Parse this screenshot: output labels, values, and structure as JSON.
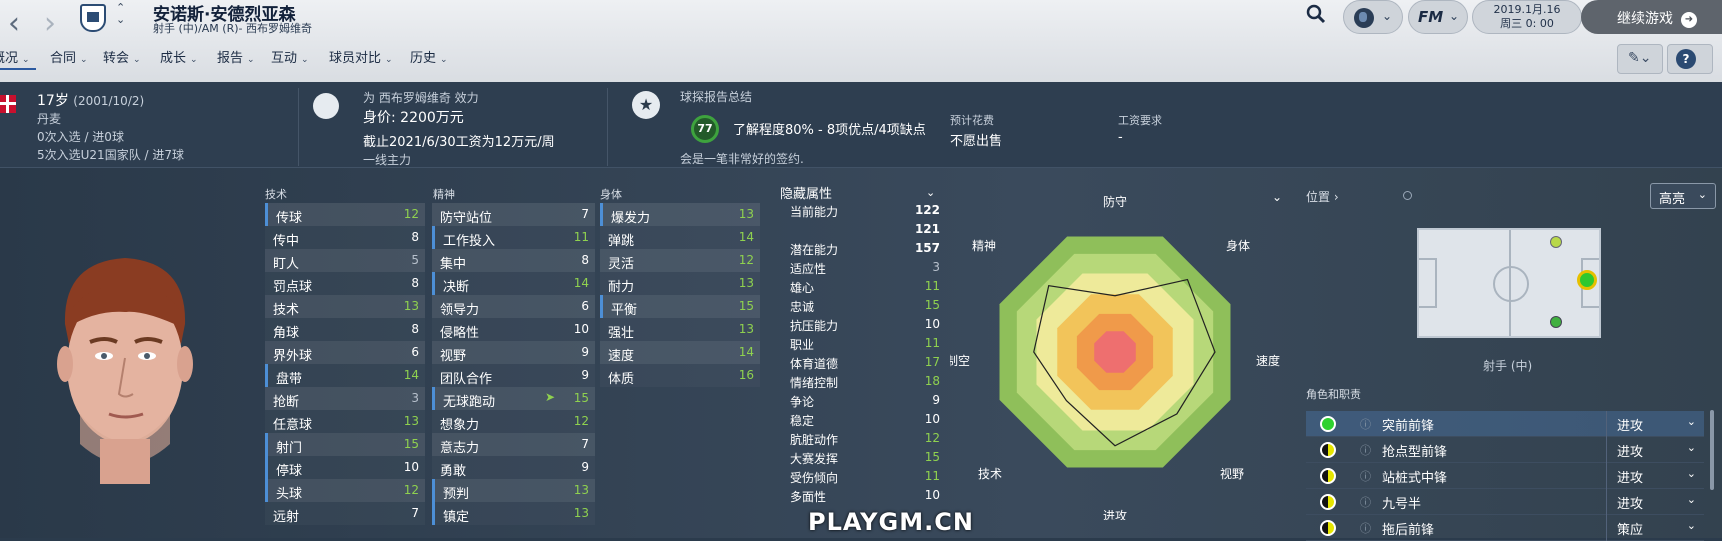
{
  "header": {
    "back_icon": "chevron-left-icon",
    "forward_icon": "chevron-right-icon",
    "player_name": "安诺斯·安德烈亚森",
    "player_role": "射手 (中)/AM (R)- 西布罗姆维奇",
    "date": "2019.1月.16",
    "time": "周三 0: 00",
    "continue_label": "继续游戏",
    "fm_label": "FM"
  },
  "tabs": [
    {
      "label": "概况"
    },
    {
      "label": "合同"
    },
    {
      "label": "转会"
    },
    {
      "label": "成长"
    },
    {
      "label": "报告"
    },
    {
      "label": "互动"
    },
    {
      "label": "球员对比"
    },
    {
      "label": "历史"
    }
  ],
  "info": {
    "age": "17岁",
    "birth": "(2001/10/2)",
    "nation": "丹麦",
    "caps1": "0次入选 / 进0球",
    "caps2": "5次入选U21国家队 / 进7球",
    "club_line": "为 西布罗姆维奇 效力",
    "value": "身价: 2200万元",
    "contract": "截止2021/6/30工资为12万元/周",
    "squad": "一线主力",
    "scout_title": "球探报告总结",
    "scout_score": "77",
    "scout_text": "了解程度80% - 8项优点/4项缺点",
    "scout_note": "会是一笔非常好的签约.",
    "fee_label": "预计花费",
    "fee_value": "不愿出售",
    "wage_label": "工资要求",
    "wage_value": "-"
  },
  "attributes": {
    "technical_title": "技术",
    "technical": [
      {
        "name": "传球",
        "value": "12"
      },
      {
        "name": "传中",
        "value": "8"
      },
      {
        "name": "盯人",
        "value": "5"
      },
      {
        "name": "罚点球",
        "value": "8"
      },
      {
        "name": "技术",
        "value": "13"
      },
      {
        "name": "角球",
        "value": "8"
      },
      {
        "name": "界外球",
        "value": "6"
      },
      {
        "name": "盘带",
        "value": "14"
      },
      {
        "name": "抢断",
        "value": "3"
      },
      {
        "name": "任意球",
        "value": "13"
      },
      {
        "name": "射门",
        "value": "15"
      },
      {
        "name": "停球",
        "value": "10"
      },
      {
        "name": "头球",
        "value": "12"
      },
      {
        "name": "远射",
        "value": "7"
      }
    ],
    "mental_title": "精神",
    "mental": [
      {
        "name": "防守站位",
        "value": "7"
      },
      {
        "name": "工作投入",
        "value": "11"
      },
      {
        "name": "集中",
        "value": "8"
      },
      {
        "name": "决断",
        "value": "14"
      },
      {
        "name": "领导力",
        "value": "6"
      },
      {
        "name": "侵略性",
        "value": "10"
      },
      {
        "name": "视野",
        "value": "9"
      },
      {
        "name": "团队合作",
        "value": "9"
      },
      {
        "name": "无球跑动",
        "value": "15"
      },
      {
        "name": "想象力",
        "value": "12"
      },
      {
        "name": "意志力",
        "value": "7"
      },
      {
        "name": "勇敢",
        "value": "9"
      },
      {
        "name": "预判",
        "value": "13"
      },
      {
        "name": "镇定",
        "value": "13"
      }
    ],
    "physical_title": "身体",
    "physical": [
      {
        "name": "爆发力",
        "value": "13"
      },
      {
        "name": "弹跳",
        "value": "14"
      },
      {
        "name": "灵活",
        "value": "12"
      },
      {
        "name": "耐力",
        "value": "13"
      },
      {
        "name": "平衡",
        "value": "15"
      },
      {
        "name": "强壮",
        "value": "13"
      },
      {
        "name": "速度",
        "value": "14"
      },
      {
        "name": "体质",
        "value": "16"
      }
    ]
  },
  "hidden": {
    "title": "隐藏属性",
    "rows": [
      {
        "name": "当前能力",
        "value": "122"
      },
      {
        "name": "",
        "value": "121"
      },
      {
        "name": "潜在能力",
        "value": "157"
      },
      {
        "name": "适应性",
        "value": "3"
      },
      {
        "name": "雄心",
        "value": "11"
      },
      {
        "name": "忠诚",
        "value": "15"
      },
      {
        "name": "抗压能力",
        "value": "10"
      },
      {
        "name": "职业",
        "value": "11"
      },
      {
        "name": "体育道德",
        "value": "17"
      },
      {
        "name": "情绪控制",
        "value": "18"
      },
      {
        "name": "争论",
        "value": "9"
      },
      {
        "name": "稳定",
        "value": "10"
      },
      {
        "name": "肮脏动作",
        "value": "12"
      },
      {
        "name": "大赛发挥",
        "value": "15"
      },
      {
        "name": "受伤倾向",
        "value": "11"
      },
      {
        "name": "多面性",
        "value": "10"
      }
    ]
  },
  "radar": {
    "labels": [
      "防守",
      "身体",
      "速度",
      "视野",
      "进攻",
      "技术",
      "制空",
      "精神"
    ],
    "values": [
      0.45,
      0.82,
      0.8,
      0.7,
      0.75,
      0.55,
      0.65,
      0.75
    ]
  },
  "position": {
    "link": "位置",
    "highlight": "高亮",
    "label": "射手 (中)",
    "roles_title": "角色和职责"
  },
  "roles": [
    {
      "name": "突前前锋",
      "duty": "进攻",
      "dot": "green"
    },
    {
      "name": "抢点型前锋",
      "duty": "进攻",
      "dot": "half"
    },
    {
      "name": "站桩式中锋",
      "duty": "进攻",
      "dot": "half"
    },
    {
      "name": "九号半",
      "duty": "进攻",
      "dot": "half"
    },
    {
      "name": "拖后前锋",
      "duty": "策应",
      "dot": "half"
    }
  ],
  "watermark": "PLAYGM.CN",
  "colors": {
    "accent": "#2c5aa0",
    "good_value": "#8fd14f",
    "normal_value": "#ffffff",
    "low_value": "#b7c0cc"
  }
}
